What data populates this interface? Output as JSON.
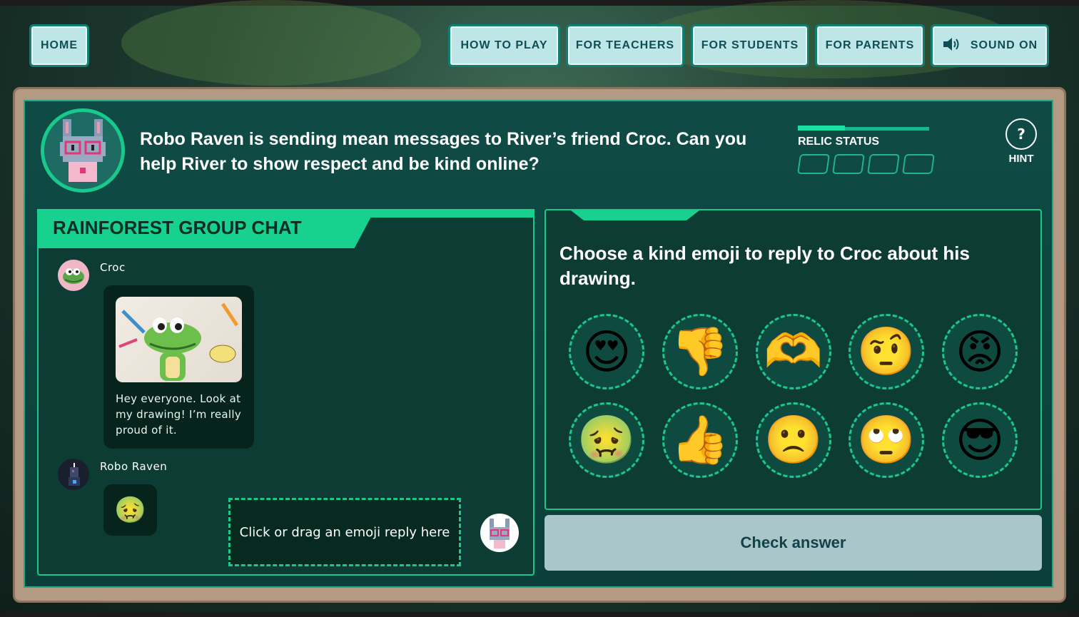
{
  "nav": {
    "home": "HOME",
    "how_to_play": "HOW TO PLAY",
    "for_teachers": "FOR TEACHERS",
    "for_students": "FOR STUDENTS",
    "for_parents": "FOR PARENTS",
    "sound": "SOUND ON"
  },
  "mission": {
    "text": "Robo Raven is sending mean messages to River’s friend Croc. Can you help River to show respect and be kind online?"
  },
  "relic": {
    "label": "RELIC STATUS",
    "progress_fraction": 0.36,
    "slots": 4
  },
  "hint": {
    "icon": "?",
    "label": "HINT"
  },
  "chat": {
    "title": "RAINFOREST GROUP CHAT",
    "messages": [
      {
        "sender": "Croc",
        "text": "Hey everyone. Look at my drawing! I’m really proud of it."
      },
      {
        "sender": "Robo Raven",
        "emoji": "🤢"
      }
    ],
    "drop_zone": "Click or drag an emoji reply here"
  },
  "question": {
    "text": "Choose a kind emoji to reply to Croc about his drawing."
  },
  "emojis": [
    "😍",
    "👎",
    "🫶",
    "🤨",
    "😡",
    "🤢",
    "👍",
    "🙁",
    "🙄",
    "😎"
  ],
  "check_button": "Check answer",
  "colors": {
    "accent": "#19d18e",
    "panel": "#0d3c34",
    "frame": "#b49a83",
    "nav_bg": "#bfe6e6"
  }
}
